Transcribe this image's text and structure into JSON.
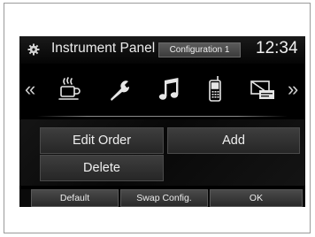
{
  "header": {
    "gear_icon": "gear-icon",
    "title": "Instrument Panel",
    "configuration": "Configuration 1",
    "clock": "12:34"
  },
  "icon_row": {
    "left_arrow": "«",
    "right_arrow": "»",
    "icons": [
      "coffee-cup-icon",
      "wrench-icon",
      "music-note-icon",
      "mobile-phone-icon",
      "display-off-icon"
    ]
  },
  "buttons": {
    "edit_order": "Edit Order",
    "add": "Add",
    "delete": "Delete"
  },
  "bottom_bar": {
    "default": "Default",
    "swap_config": "Swap Config.",
    "ok": "OK"
  }
}
